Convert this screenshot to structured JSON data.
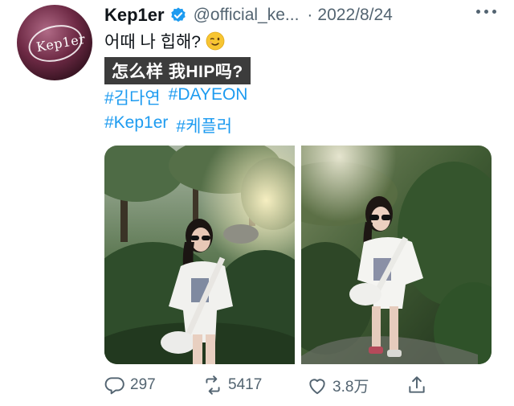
{
  "tweet": {
    "name": "Kep1er",
    "handle": "@official_ke...",
    "separator": "·",
    "date": "2022/8/24",
    "avatar_text": "Kep1er",
    "line1": "어때 나 힙해?",
    "translation": "怎么样 我HIP吗?",
    "hashtags_row1": [
      "#김다연",
      "#DAYEON"
    ],
    "hashtags_row2": [
      "#Kep1er",
      "#케플러"
    ]
  },
  "actions": {
    "reply_count": "297",
    "retweet_count": "5417",
    "like_count": "3.8万"
  },
  "colors": {
    "link": "#1d9bf0",
    "muted": "#536471",
    "verified": "#1d9bf0",
    "banner_bg": "#3c3c3c"
  },
  "icons": [
    "verified-badge-icon",
    "wink-emoji-icon",
    "more-icon",
    "reply-icon",
    "retweet-icon",
    "like-icon",
    "share-icon"
  ]
}
